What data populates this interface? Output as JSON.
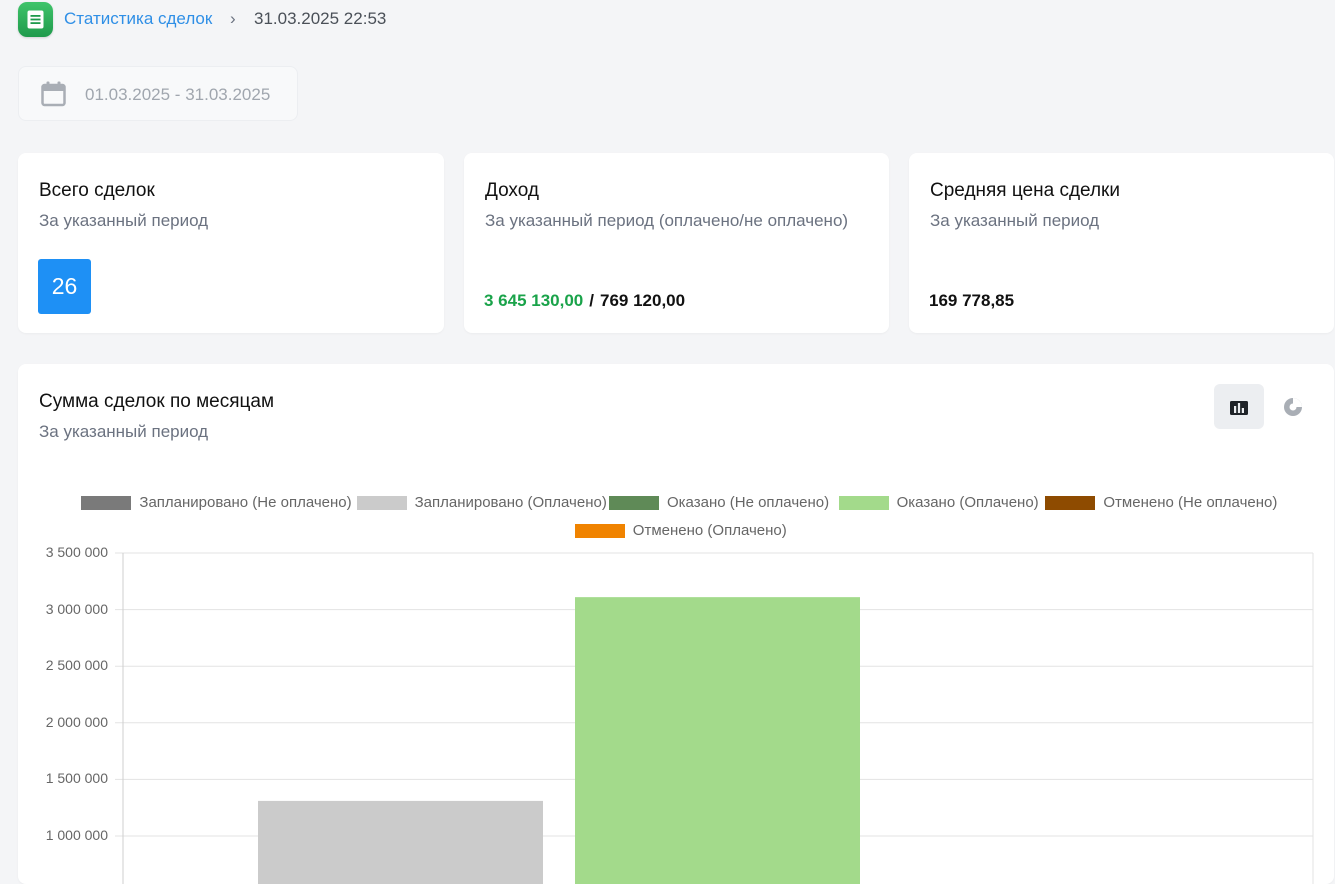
{
  "breadcrumb": {
    "link": "Статистика сделок",
    "separator": "›",
    "current": "31.03.2025 22:53"
  },
  "date_range": {
    "value": "01.03.2025 - 31.03.2025",
    "icon": "calendar-icon"
  },
  "cards": {
    "total": {
      "title": "Всего сделок",
      "subtitle": "За указанный период",
      "value": "26"
    },
    "income": {
      "title": "Доход",
      "subtitle": "За указанный период (оплачено/не оплачено)",
      "paid": "3 645 130,00",
      "separator": "/",
      "unpaid": "769 120,00"
    },
    "average": {
      "title": "Средняя цена сделки",
      "subtitle": "За указанный период",
      "value": "169 778,85"
    }
  },
  "chart_card": {
    "title": "Сумма сделок по месяцам",
    "subtitle": "За указанный период",
    "view_buttons": [
      {
        "icon": "bar-chart-icon",
        "active": true
      },
      {
        "icon": "pie-chart-icon",
        "active": false
      }
    ]
  },
  "colors": {
    "accent": "#2f8fe6",
    "badge": "#1e90f5",
    "paid_green": "#1aa34a"
  },
  "chart_data": {
    "type": "bar",
    "ylim": [
      0,
      3500000
    ],
    "y_ticks": [
      {
        "value": 3500000,
        "label": "3 500 000"
      },
      {
        "value": 3000000,
        "label": "3 000 000"
      },
      {
        "value": 2500000,
        "label": "2 500 000"
      },
      {
        "value": 2000000,
        "label": "2 000 000"
      },
      {
        "value": 1500000,
        "label": "1 500 000"
      },
      {
        "value": 1000000,
        "label": "1 000 000"
      }
    ],
    "grid": true,
    "legend_position": "top-center",
    "series": [
      {
        "name": "Запланировано (Не оплачено)",
        "color": "#7a7a7a",
        "values": [
          0
        ]
      },
      {
        "name": "Запланировано (Оплачено)",
        "color": "#cbcbcb",
        "values": [
          1310000
        ]
      },
      {
        "name": "Оказано (Не оплачено)",
        "color": "#5f8a57",
        "values": [
          0
        ]
      },
      {
        "name": "Оказано (Оплачено)",
        "color": "#a3da8b",
        "values": [
          3110000
        ]
      },
      {
        "name": "Отменено (Не оплачено)",
        "color": "#8e4b00",
        "values": [
          0
        ]
      },
      {
        "name": "Отменено (Оплачено)",
        "color": "#f08300",
        "values": [
          0
        ]
      }
    ]
  }
}
